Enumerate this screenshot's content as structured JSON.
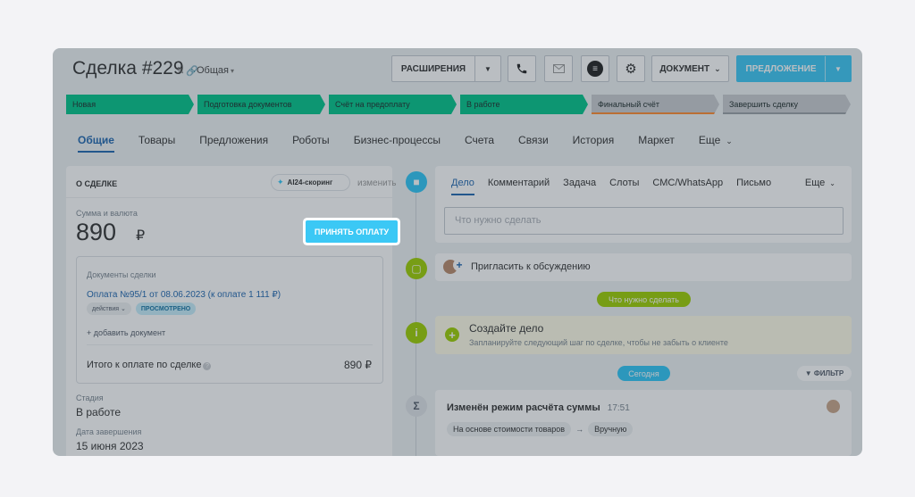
{
  "header": {
    "title": "Сделка #229",
    "category": "Общая",
    "toolbar": {
      "extensions": "РАСШИРЕНИЯ",
      "document": "ДОКУМЕНТ",
      "offer": "ПРЕДЛОЖЕНИЕ"
    }
  },
  "stages": [
    {
      "label": "Новая"
    },
    {
      "label": "Подготовка документов"
    },
    {
      "label": "Счёт на предоплату"
    },
    {
      "label": "В работе"
    },
    {
      "label": "Финальный счёт"
    },
    {
      "label": "Завершить сделку"
    }
  ],
  "tabs": [
    {
      "label": "Общие"
    },
    {
      "label": "Товары"
    },
    {
      "label": "Предложения"
    },
    {
      "label": "Роботы"
    },
    {
      "label": "Бизнес-процессы"
    },
    {
      "label": "Счета"
    },
    {
      "label": "Связи"
    },
    {
      "label": "История"
    },
    {
      "label": "Маркет"
    },
    {
      "label": "Еще"
    }
  ],
  "deal": {
    "section_title": "О СДЕЛКЕ",
    "ai_badge": "AI24-скоринг",
    "change": "изменить",
    "sum_label": "Сумма и валюта",
    "sum_value": "890",
    "currency": "₽",
    "accept_payment": "ПРИНЯТЬ ОПЛАТУ",
    "docs": {
      "label": "Документы сделки",
      "link": "Оплата №95/1 от 08.06.2023 (к оплате 1 111 ₽)",
      "actions": "действия",
      "viewed": "ПРОСМОТРЕНО",
      "add": "+ добавить документ",
      "total_label": "Итого к оплате по сделке",
      "total_value": "890 ₽"
    },
    "stage_label": "Стадия",
    "stage_value": "В работе",
    "close_label": "Дата завершения",
    "close_value": "15 июня 2023"
  },
  "editor": {
    "tabs": [
      "Дело",
      "Комментарий",
      "Задача",
      "Слоты",
      "СМС/WhatsApp",
      "Письмо"
    ],
    "more": "Еще",
    "placeholder": "Что нужно сделать"
  },
  "timeline": {
    "invite": "Пригласить к обсуждению",
    "todo_pill": "Что нужно сделать",
    "todo_title": "Создайте дело",
    "todo_hint": "Запланируйте следующий шаг по сделке, чтобы не забыть о клиенте",
    "today": "Сегодня",
    "filter": "ФИЛЬТР",
    "history_title": "Изменён режим расчёта суммы",
    "history_time": "17:51",
    "chip_from": "На основе стоимости товаров",
    "chip_to": "Вручную"
  },
  "colors": {
    "accent": "#3bc8f5",
    "stage_done": "#00c58a",
    "link": "#2067b0",
    "green": "#9dcf00"
  }
}
